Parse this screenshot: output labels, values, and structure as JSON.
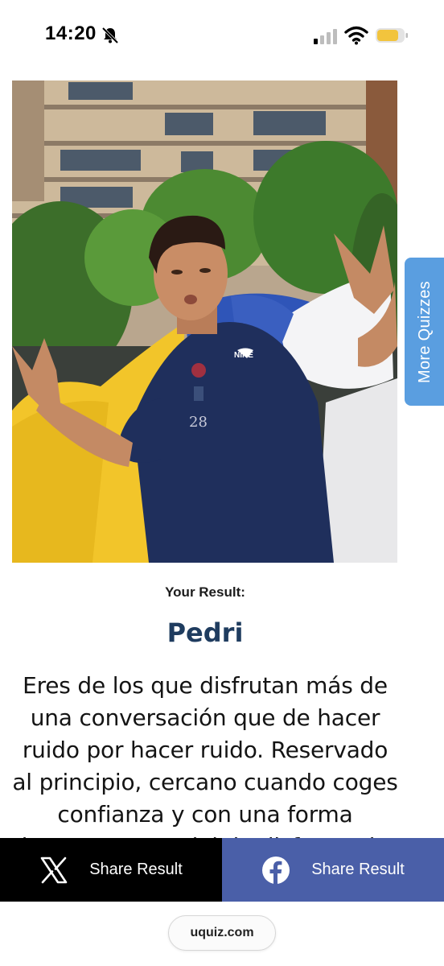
{
  "status_bar": {
    "time": "14:20",
    "icons": [
      "bell-slash-icon",
      "signal-icon",
      "wifi-icon",
      "battery-icon"
    ],
    "battery_color": "#f2c43d"
  },
  "side_tab": {
    "label": "More Quizzes",
    "color": "#5a9ee0"
  },
  "result": {
    "heading": "Your Result:",
    "name": "Pedri",
    "name_color": "#1f3c5f",
    "description": "Eres de los que disfrutan más de una conversación que de hacer ruido por hacer ruido. Reservado al principio, cercano cuando coges confianza y con una forma bastante especial de disfrutar de"
  },
  "share": {
    "x_label": "Share Result",
    "x_icon": "x-logo-icon",
    "facebook_label": "Share Result",
    "facebook_icon": "facebook-logo-icon",
    "x_color": "#000000",
    "facebook_color": "#4a5fa8"
  },
  "footer": {
    "url": "uquiz.com"
  }
}
